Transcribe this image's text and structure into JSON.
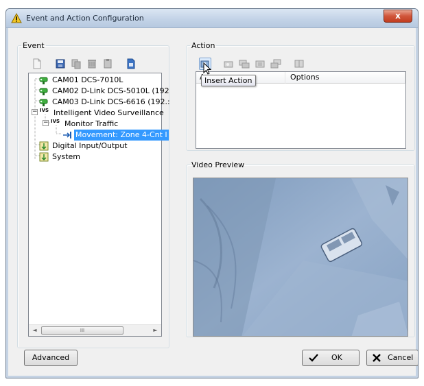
{
  "window": {
    "title": "Event and Action Configuration",
    "close_label": "x"
  },
  "event_group": {
    "legend": "Event",
    "toolbar_icons": [
      "new-page-icon",
      "save-icon",
      "copy-icon",
      "delete-icon",
      "paste-icon",
      "export-icon"
    ],
    "tree": [
      {
        "label": "CAM01 DCS-7010L",
        "icon": "camera-icon",
        "level": 1
      },
      {
        "label": "CAM02 D-Link DCS-5010L (192",
        "icon": "camera-icon",
        "level": 1
      },
      {
        "label": "CAM03 D-Link DCS-6616 (192.:",
        "icon": "camera-icon",
        "level": 1
      },
      {
        "label": "Intelligent Video Surveillance",
        "icon": "ivs-icon",
        "icon_text": "IVS",
        "level": 1,
        "expanded": true
      },
      {
        "label": "Monitor Traffic",
        "icon": "ivs-icon",
        "icon_text": "IVS",
        "level": 2,
        "expanded": true
      },
      {
        "label": "Movement: Zone 4-Cnt I",
        "icon": "movement-icon",
        "level": 3,
        "selected": true
      },
      {
        "label": "Digital Input/Output",
        "icon": "io-icon",
        "level": 1
      },
      {
        "label": "System",
        "icon": "system-icon",
        "level": 1
      }
    ],
    "scroll_thumb_grip": "III"
  },
  "action_group": {
    "legend": "Action",
    "toolbar_icons": [
      "insert-action-icon",
      "edit-action-icon",
      "copy-action-icon",
      "delete-action-icon",
      "paste-action-icon",
      "test-action-icon"
    ],
    "columns": [
      "A",
      "Options"
    ],
    "tooltip": "Insert Action"
  },
  "preview_group": {
    "legend": "Video Preview"
  },
  "buttons": {
    "advanced": "Advanced",
    "ok": "OK",
    "cancel": "Cancel"
  },
  "colors": {
    "selection": "#3399ff",
    "preview_tint": "#8fa8c6",
    "close_button": "#c94a2c"
  }
}
